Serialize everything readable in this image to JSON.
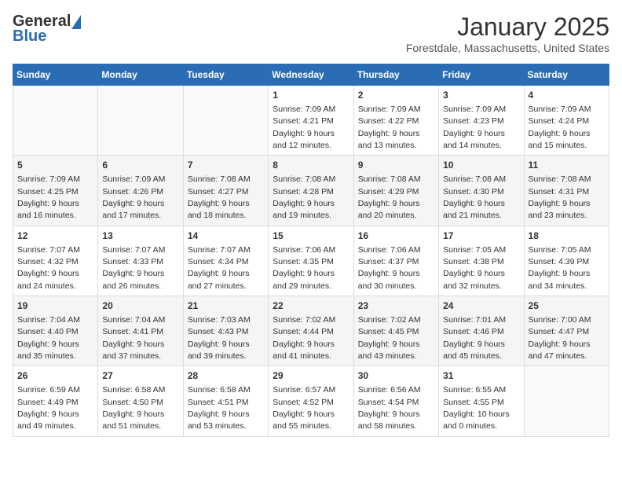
{
  "header": {
    "logo_general": "General",
    "logo_blue": "Blue",
    "month": "January 2025",
    "location": "Forestdale, Massachusetts, United States"
  },
  "weekdays": [
    "Sunday",
    "Monday",
    "Tuesday",
    "Wednesday",
    "Thursday",
    "Friday",
    "Saturday"
  ],
  "weeks": [
    [
      {
        "day": "",
        "info": ""
      },
      {
        "day": "",
        "info": ""
      },
      {
        "day": "",
        "info": ""
      },
      {
        "day": "1",
        "info": "Sunrise: 7:09 AM\nSunset: 4:21 PM\nDaylight: 9 hours\nand 12 minutes."
      },
      {
        "day": "2",
        "info": "Sunrise: 7:09 AM\nSunset: 4:22 PM\nDaylight: 9 hours\nand 13 minutes."
      },
      {
        "day": "3",
        "info": "Sunrise: 7:09 AM\nSunset: 4:23 PM\nDaylight: 9 hours\nand 14 minutes."
      },
      {
        "day": "4",
        "info": "Sunrise: 7:09 AM\nSunset: 4:24 PM\nDaylight: 9 hours\nand 15 minutes."
      }
    ],
    [
      {
        "day": "5",
        "info": "Sunrise: 7:09 AM\nSunset: 4:25 PM\nDaylight: 9 hours\nand 16 minutes."
      },
      {
        "day": "6",
        "info": "Sunrise: 7:09 AM\nSunset: 4:26 PM\nDaylight: 9 hours\nand 17 minutes."
      },
      {
        "day": "7",
        "info": "Sunrise: 7:08 AM\nSunset: 4:27 PM\nDaylight: 9 hours\nand 18 minutes."
      },
      {
        "day": "8",
        "info": "Sunrise: 7:08 AM\nSunset: 4:28 PM\nDaylight: 9 hours\nand 19 minutes."
      },
      {
        "day": "9",
        "info": "Sunrise: 7:08 AM\nSunset: 4:29 PM\nDaylight: 9 hours\nand 20 minutes."
      },
      {
        "day": "10",
        "info": "Sunrise: 7:08 AM\nSunset: 4:30 PM\nDaylight: 9 hours\nand 21 minutes."
      },
      {
        "day": "11",
        "info": "Sunrise: 7:08 AM\nSunset: 4:31 PM\nDaylight: 9 hours\nand 23 minutes."
      }
    ],
    [
      {
        "day": "12",
        "info": "Sunrise: 7:07 AM\nSunset: 4:32 PM\nDaylight: 9 hours\nand 24 minutes."
      },
      {
        "day": "13",
        "info": "Sunrise: 7:07 AM\nSunset: 4:33 PM\nDaylight: 9 hours\nand 26 minutes."
      },
      {
        "day": "14",
        "info": "Sunrise: 7:07 AM\nSunset: 4:34 PM\nDaylight: 9 hours\nand 27 minutes."
      },
      {
        "day": "15",
        "info": "Sunrise: 7:06 AM\nSunset: 4:35 PM\nDaylight: 9 hours\nand 29 minutes."
      },
      {
        "day": "16",
        "info": "Sunrise: 7:06 AM\nSunset: 4:37 PM\nDaylight: 9 hours\nand 30 minutes."
      },
      {
        "day": "17",
        "info": "Sunrise: 7:05 AM\nSunset: 4:38 PM\nDaylight: 9 hours\nand 32 minutes."
      },
      {
        "day": "18",
        "info": "Sunrise: 7:05 AM\nSunset: 4:39 PM\nDaylight: 9 hours\nand 34 minutes."
      }
    ],
    [
      {
        "day": "19",
        "info": "Sunrise: 7:04 AM\nSunset: 4:40 PM\nDaylight: 9 hours\nand 35 minutes."
      },
      {
        "day": "20",
        "info": "Sunrise: 7:04 AM\nSunset: 4:41 PM\nDaylight: 9 hours\nand 37 minutes."
      },
      {
        "day": "21",
        "info": "Sunrise: 7:03 AM\nSunset: 4:43 PM\nDaylight: 9 hours\nand 39 minutes."
      },
      {
        "day": "22",
        "info": "Sunrise: 7:02 AM\nSunset: 4:44 PM\nDaylight: 9 hours\nand 41 minutes."
      },
      {
        "day": "23",
        "info": "Sunrise: 7:02 AM\nSunset: 4:45 PM\nDaylight: 9 hours\nand 43 minutes."
      },
      {
        "day": "24",
        "info": "Sunrise: 7:01 AM\nSunset: 4:46 PM\nDaylight: 9 hours\nand 45 minutes."
      },
      {
        "day": "25",
        "info": "Sunrise: 7:00 AM\nSunset: 4:47 PM\nDaylight: 9 hours\nand 47 minutes."
      }
    ],
    [
      {
        "day": "26",
        "info": "Sunrise: 6:59 AM\nSunset: 4:49 PM\nDaylight: 9 hours\nand 49 minutes."
      },
      {
        "day": "27",
        "info": "Sunrise: 6:58 AM\nSunset: 4:50 PM\nDaylight: 9 hours\nand 51 minutes."
      },
      {
        "day": "28",
        "info": "Sunrise: 6:58 AM\nSunset: 4:51 PM\nDaylight: 9 hours\nand 53 minutes."
      },
      {
        "day": "29",
        "info": "Sunrise: 6:57 AM\nSunset: 4:52 PM\nDaylight: 9 hours\nand 55 minutes."
      },
      {
        "day": "30",
        "info": "Sunrise: 6:56 AM\nSunset: 4:54 PM\nDaylight: 9 hours\nand 58 minutes."
      },
      {
        "day": "31",
        "info": "Sunrise: 6:55 AM\nSunset: 4:55 PM\nDaylight: 10 hours\nand 0 minutes."
      },
      {
        "day": "",
        "info": ""
      }
    ]
  ]
}
